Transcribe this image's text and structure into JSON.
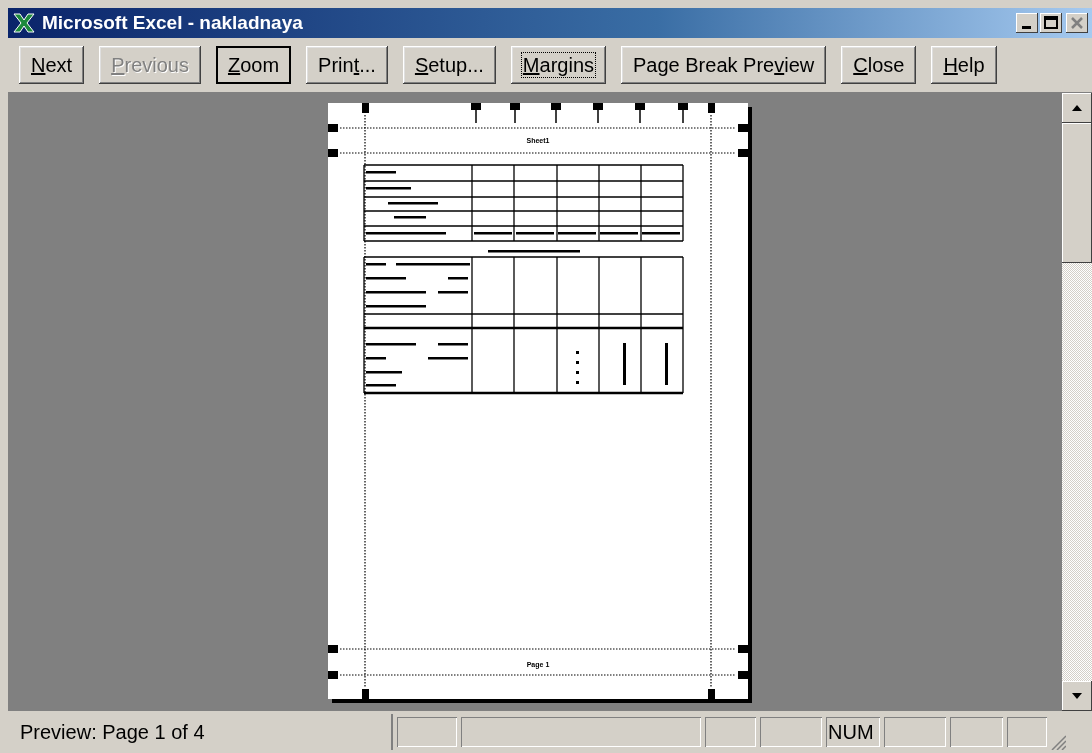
{
  "window": {
    "title": "Microsoft Excel - nakladnaya"
  },
  "toolbar": [
    {
      "key": "N",
      "after": "ext",
      "disabled": false,
      "default": false,
      "pressed": false
    },
    {
      "key": "P",
      "after": "revious",
      "disabled": true,
      "default": false,
      "pressed": false
    },
    {
      "key": "Z",
      "after": "oom",
      "disabled": false,
      "default": true,
      "pressed": false
    },
    {
      "before": "Prin",
      "key": "t",
      "after": "...",
      "disabled": false,
      "default": false,
      "pressed": false
    },
    {
      "key": "S",
      "after": "etup...",
      "disabled": false,
      "default": false,
      "pressed": false
    },
    {
      "key": "M",
      "after": "argins",
      "disabled": false,
      "default": false,
      "pressed": true
    },
    {
      "before": "Page Break Pre",
      "key": "v",
      "after": "iew",
      "disabled": false,
      "default": false,
      "pressed": false
    },
    {
      "key": "C",
      "after": "lose",
      "disabled": false,
      "default": false,
      "pressed": false
    },
    {
      "key": "H",
      "after": "elp",
      "disabled": false,
      "default": false,
      "pressed": false
    }
  ],
  "page": {
    "header": "Sheet1",
    "footer": "Page 1"
  },
  "status_bar": {
    "text": "Preview: Page 1 of 4",
    "indicator": "NUM"
  }
}
